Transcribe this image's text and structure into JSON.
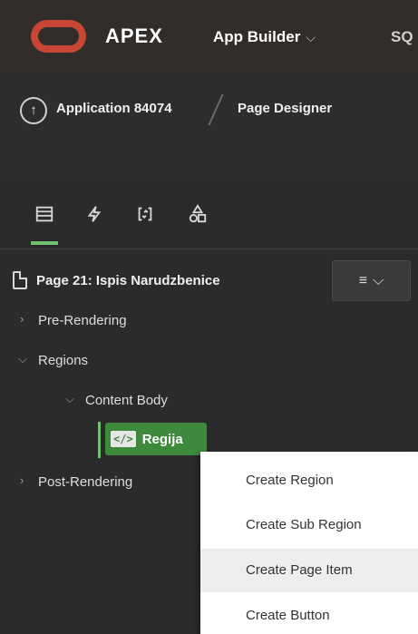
{
  "header": {
    "brand": "APEX",
    "app_builder_menu": "App Builder",
    "sql_menu_partial": "SQ"
  },
  "breadcrumb": {
    "application": "Application 84074",
    "page_designer": "Page Designer"
  },
  "tabs": [
    {
      "icon": "rendering-icon",
      "active": true
    },
    {
      "icon": "dynamic-actions-icon",
      "active": false
    },
    {
      "icon": "processing-icon",
      "active": false
    },
    {
      "icon": "shared-components-icon",
      "active": false
    }
  ],
  "tree": {
    "page_title": "Page 21: Ispis Narudzbenice",
    "menu_button_glyph": "≡",
    "pre_rendering": "Pre-Rendering",
    "regions": "Regions",
    "content_body": "Content Body",
    "region_code_badge": "</>",
    "region_name": "Regija",
    "post_rendering": "Post-Rendering"
  },
  "context_menu": {
    "items": [
      {
        "label": "Create Region"
      },
      {
        "label": "Create Sub Region"
      },
      {
        "label": "Create Page Item"
      },
      {
        "label": "Create Button"
      }
    ]
  },
  "colors": {
    "oracle_red": "#c74634",
    "region_green": "#3d8a3d",
    "active_tab_underline": "#6fc16f"
  }
}
